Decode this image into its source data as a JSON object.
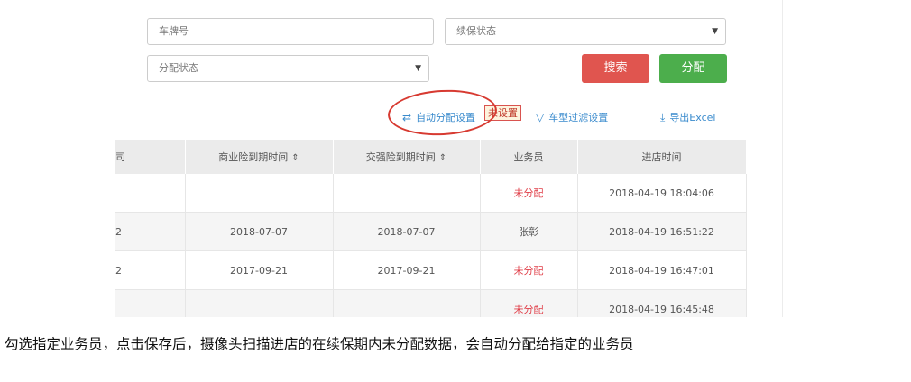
{
  "filters": {
    "plate_placeholder": "车牌号",
    "renewal_status_label": "续保状态",
    "assign_status_label": "分配状态",
    "arrow_glyph": "▼"
  },
  "buttons": {
    "search": "搜索",
    "assign": "分配"
  },
  "toolbar": {
    "auto_assign": "自动分配设置",
    "auto_assign_tag": "未设置",
    "model_filter": "车型过滤设置",
    "export": "导出Excel"
  },
  "table": {
    "headers": [
      "司",
      "商业险到期时间",
      "交强险到期时间",
      "业务员",
      "进店时间"
    ],
    "sort_glyph": "⇕",
    "rows": [
      {
        "c0": "",
        "commercial": "",
        "compulsory": "",
        "agent": "未分配",
        "visit": "2018-04-19 18:04:06"
      },
      {
        "c0": "2",
        "commercial": "2018-07-07",
        "compulsory": "2018-07-07",
        "agent": "张彰",
        "visit": "2018-04-19 16:51:22"
      },
      {
        "c0": "2",
        "commercial": "2017-09-21",
        "compulsory": "2017-09-21",
        "agent": "未分配",
        "visit": "2018-04-19 16:47:01"
      },
      {
        "c0": "",
        "commercial": "",
        "compulsory": "",
        "agent": "未分配",
        "visit": "2018-04-19 16:45:48"
      }
    ]
  },
  "caption": "勾选指定业务员，点击保存后，摄像头扫描进店的在续保期内未分配数据，会自动分配给指定的业务员",
  "colors": {
    "search_button": "#e0554f",
    "assign_button": "#4cae4c",
    "link": "#3a8bcd",
    "unassigned": "#e0404a",
    "annotation_circle": "#d73a31"
  }
}
